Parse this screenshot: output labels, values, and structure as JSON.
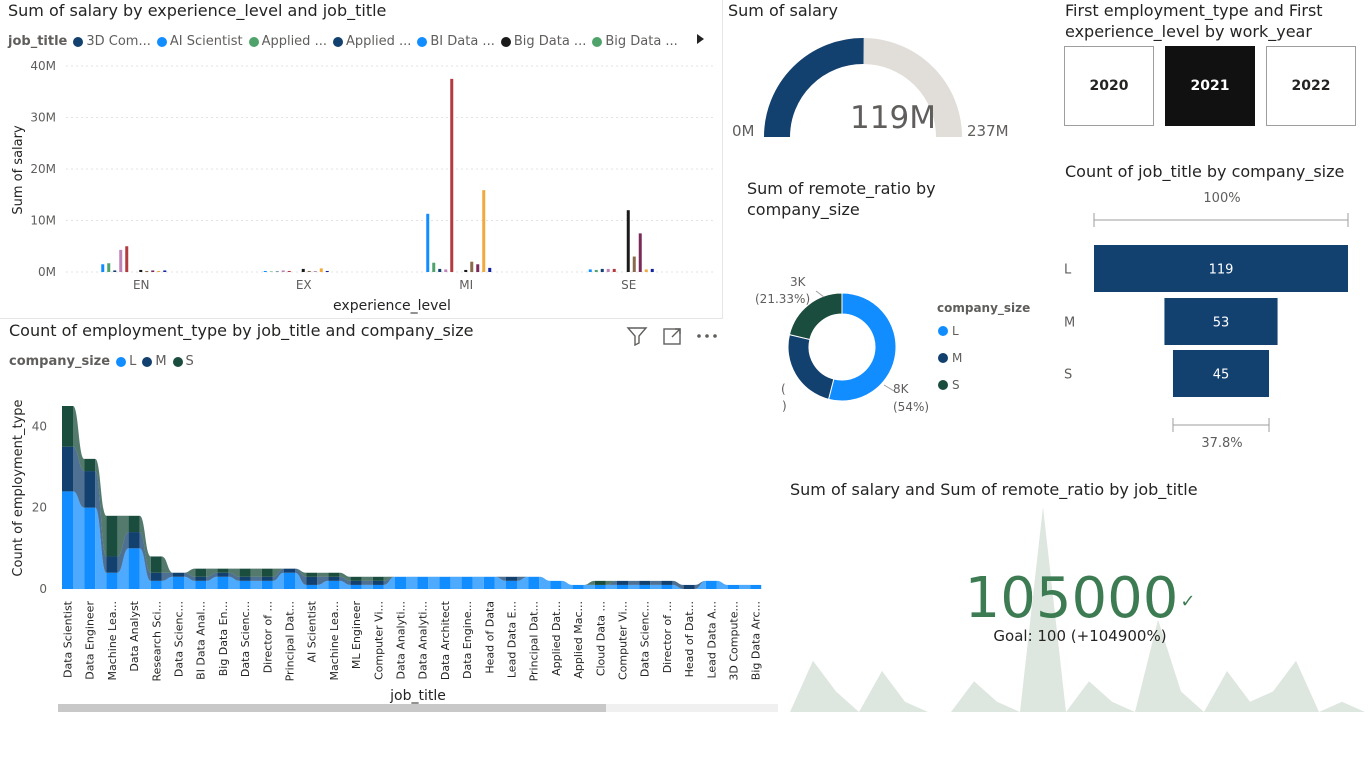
{
  "colors": {
    "L": "#118dff",
    "M": "#12239e",
    "S": "#1b4d3e",
    "navy": "#12406f",
    "gaugeFill": "#12406f",
    "gaugeTrack": "#e1ddd8",
    "kpi": "#3d7c53"
  },
  "salary_by_exp": {
    "title": "Sum of salary by experience_level and job_title",
    "legend_title": "job_title",
    "legend_items": [
      {
        "label": "3D Com...",
        "color": "#12406f"
      },
      {
        "label": "AI Scientist",
        "color": "#118dff"
      },
      {
        "label": "Applied ...",
        "color": "#4fa36a"
      },
      {
        "label": "Applied ...",
        "color": "#12406f"
      },
      {
        "label": "BI Data ...",
        "color": "#118dff"
      },
      {
        "label": "Big Data ...",
        "color": "#1a1a1a"
      },
      {
        "label": "Big Data ...",
        "color": "#4fa36a"
      }
    ]
  },
  "gauge": {
    "title": "Sum of salary",
    "value_label": "119M",
    "min_label": "0M",
    "max_label": "237M",
    "fraction": 0.5
  },
  "slicer": {
    "title_line1": "First employment_type and First",
    "title_line2": "experience_level by work_year",
    "options": [
      "2020",
      "2021",
      "2022"
    ],
    "selected": "2021"
  },
  "remote_donut": {
    "title_line1": "Sum of remote_ratio by",
    "title_line2": "company_size",
    "legend_title": "company_size",
    "label_top": "3K",
    "label_top_pct": "(21.33%)",
    "label_right": "8K",
    "label_right_pct": "(54%)",
    "label_left_partial": "(",
    "label_left_partial2": ")"
  },
  "funnel": {
    "title": "Count of job_title by company_size",
    "top_pct": "100%",
    "bottom_pct": "37.8%"
  },
  "ribbon": {
    "title": "Count of employment_type by job_title and company_size",
    "legend_title": "company_size"
  },
  "kpi": {
    "title": "Sum of salary and Sum of remote_ratio by job_title",
    "value": "105000",
    "goal_text": "Goal: 100 (+104900%)"
  },
  "chart_data": [
    {
      "id": "salary_by_exp",
      "type": "bar",
      "title": "Sum of salary by experience_level and job_title",
      "xlabel": "experience_level",
      "ylabel": "Sum of salary",
      "categories": [
        "EN",
        "EX",
        "MI",
        "SE"
      ],
      "yticks": [
        "0M",
        "10M",
        "20M",
        "30M",
        "40M"
      ],
      "ylim": [
        0,
        40
      ],
      "grid": true,
      "legend_placement": "top",
      "series": [
        {
          "color": "#118dff",
          "values": [
            1.5,
            0.2,
            11.3,
            0.5
          ]
        },
        {
          "color": "#4fa36a",
          "values": [
            1.7,
            0.1,
            1.8,
            0.4
          ]
        },
        {
          "color": "#12406f",
          "values": [
            0.3,
            0.1,
            0.6,
            0.6
          ]
        },
        {
          "color": "#c083b7",
          "values": [
            4.3,
            0.3,
            0.5,
            0.6
          ]
        },
        {
          "color": "#b33b3f",
          "values": [
            5.0,
            0.2,
            37.5,
            0.6
          ]
        },
        {
          "color": "#1a1a1a",
          "values": [
            0.4,
            0.6,
            0.4,
            12.0
          ]
        },
        {
          "color": "#8a6a4a",
          "values": [
            0.2,
            0.2,
            2.0,
            3.0
          ]
        },
        {
          "color": "#7a2a5a",
          "values": [
            0.3,
            0.1,
            1.5,
            7.5
          ]
        },
        {
          "color": "#f2a93b",
          "values": [
            0.2,
            0.7,
            15.9,
            0.5
          ]
        },
        {
          "color": "#12239e",
          "values": [
            0.3,
            0.2,
            0.8,
            0.6
          ]
        }
      ]
    },
    {
      "id": "gauge",
      "type": "gauge",
      "title": "Sum of salary",
      "value": 119,
      "min": 0,
      "max": 237,
      "unit": "M"
    },
    {
      "id": "remote_donut",
      "type": "pie",
      "title": "Sum of remote_ratio by company_size",
      "categories": [
        "L",
        "M",
        "S"
      ],
      "values": [
        54,
        24.67,
        21.33
      ],
      "legend_placement": "right"
    },
    {
      "id": "funnel",
      "type": "bar",
      "title": "Count of job_title by company_size",
      "categories": [
        "L",
        "M",
        "S"
      ],
      "values": [
        119,
        53,
        45
      ]
    },
    {
      "id": "ribbon",
      "type": "bar",
      "title": "Count of employment_type by job_title and company_size",
      "xlabel": "job_title",
      "ylabel": "Count of employment_type",
      "ylim": [
        0,
        45
      ],
      "yticks": [
        "0",
        "20",
        "40"
      ],
      "legend_placement": "top-left",
      "categories": [
        "Data Scientist",
        "Data Engineer",
        "Machine Lea...",
        "Data Analyst",
        "Research Sci...",
        "Data Scienc...",
        "BI Data Anal...",
        "Big Data En...",
        "Data Scienc...",
        "Director of ...",
        "Principal Dat...",
        "AI Scientist",
        "Machine Lea...",
        "ML Engineer",
        "Computer Vi...",
        "Data Analyti...",
        "Data Analyti...",
        "Data Architect",
        "Data Engine...",
        "Head of Data",
        "Lead Data E...",
        "Principal Dat...",
        "Applied Dat...",
        "Applied Mac...",
        "Cloud Data ...",
        "Computer Vi...",
        "Data Scienc...",
        "Director of ...",
        "Head of Dat...",
        "Lead Data A...",
        "3D Compute...",
        "Big Data Arc..."
      ],
      "series": [
        {
          "name": "L",
          "values": [
            24,
            20,
            4,
            10,
            2,
            3,
            2,
            3,
            2,
            2,
            4,
            1,
            2,
            1,
            1,
            3,
            3,
            3,
            3,
            3,
            2,
            3,
            2,
            1,
            1,
            1,
            1,
            1,
            0,
            2,
            1,
            1
          ]
        },
        {
          "name": "M",
          "values": [
            11,
            9,
            4,
            4,
            2,
            1,
            1,
            1,
            1,
            1,
            1,
            2,
            1,
            1,
            1,
            0,
            0,
            0,
            0,
            0,
            1,
            0,
            0,
            0,
            0,
            1,
            1,
            1,
            1,
            0,
            0,
            0
          ]
        },
        {
          "name": "S",
          "values": [
            10,
            3,
            10,
            4,
            4,
            0,
            2,
            1,
            2,
            2,
            0,
            1,
            1,
            1,
            1,
            0,
            0,
            0,
            0,
            0,
            0,
            0,
            0,
            0,
            1,
            0,
            0,
            0,
            0,
            0,
            0,
            0
          ]
        }
      ]
    },
    {
      "id": "kpi",
      "type": "area",
      "title": "Sum of salary and Sum of remote_ratio by job_title",
      "value": 105000,
      "goal": 100,
      "trend": [
        0,
        5,
        2,
        0,
        4,
        1,
        0,
        0,
        3,
        1,
        0,
        20,
        0,
        3,
        1,
        0,
        9,
        2,
        0,
        4,
        1,
        2,
        5,
        0,
        1,
        0
      ]
    }
  ]
}
